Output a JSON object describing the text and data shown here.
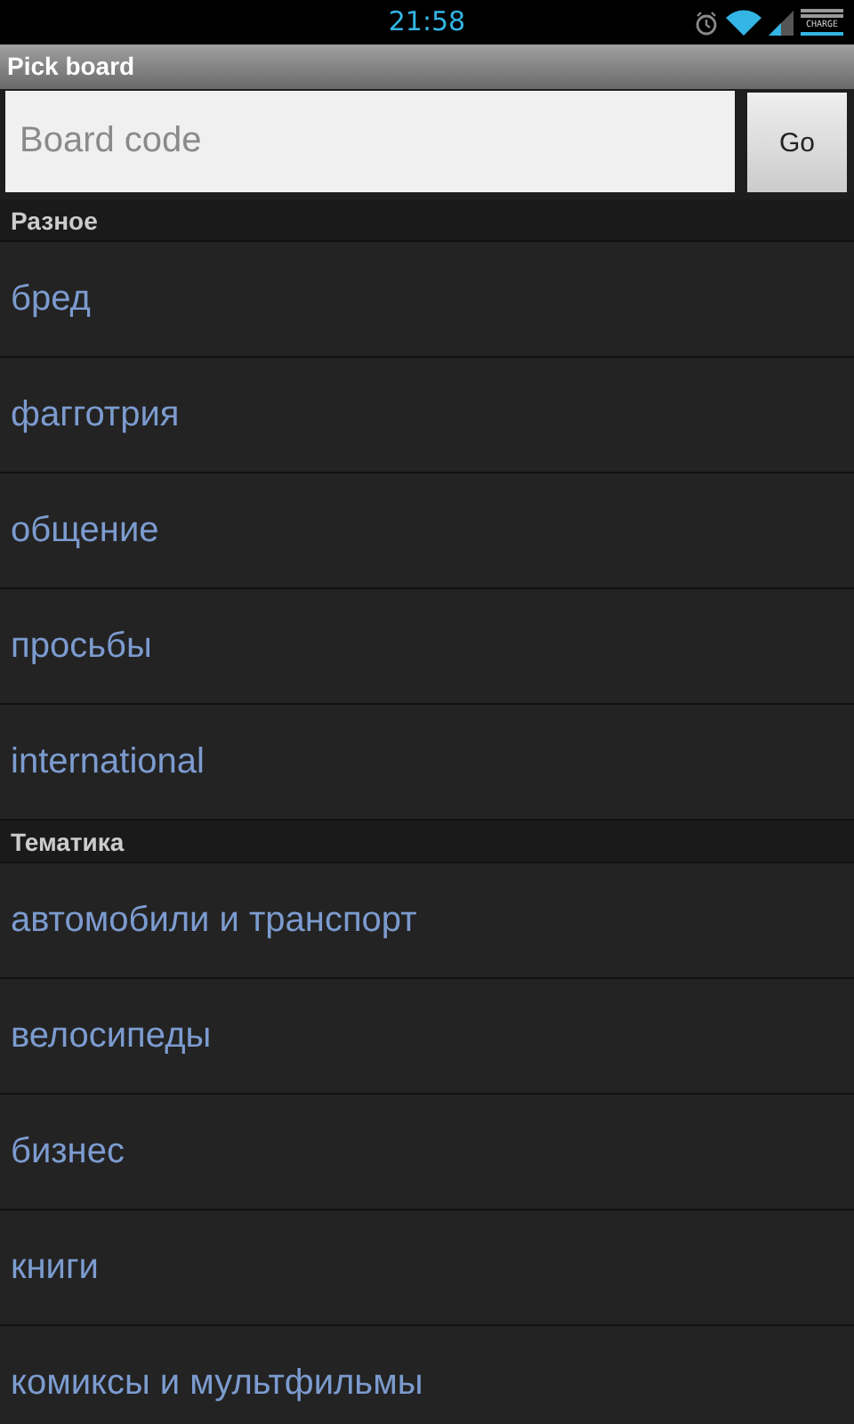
{
  "status_bar": {
    "time": "21:58",
    "battery_label": "CHARGE"
  },
  "title_bar": {
    "title": "Pick board"
  },
  "search": {
    "placeholder": "Board code",
    "button": "Go"
  },
  "sections": [
    {
      "header": "Разное",
      "items": [
        "бред",
        "фагготрия",
        "общение",
        "просьбы",
        "international"
      ]
    },
    {
      "header": "Тематика",
      "items": [
        "автомобили и транспорт",
        "велосипеды",
        "бизнес",
        "книги",
        "комиксы и мультфильмы"
      ]
    }
  ]
}
